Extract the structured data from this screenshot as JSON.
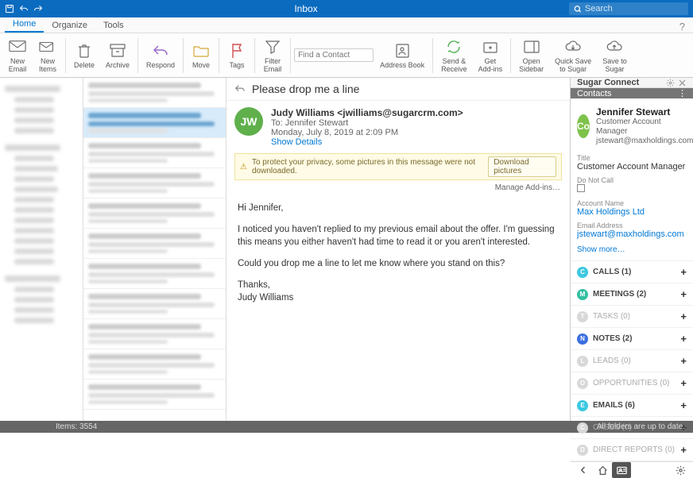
{
  "title": "Inbox",
  "search_placeholder": "Search",
  "tabs": {
    "home": "Home",
    "organize": "Organize",
    "tools": "Tools"
  },
  "ribbon": {
    "new_email": "New\nEmail",
    "new_items": "New\nItems",
    "delete": "Delete",
    "archive": "Archive",
    "respond": "Respond",
    "move": "Move",
    "tags": "Tags",
    "filter_email": "Filter\nEmail",
    "find_contact_placeholder": "Find a Contact",
    "address_book": "Address Book",
    "send_receive": "Send &\nReceive",
    "get_addins": "Get\nAdd-ins",
    "open_sidebar": "Open\nSidebar",
    "quick_save": "Quick Save\nto Sugar",
    "save_sugar": "Save to\nSugar"
  },
  "message": {
    "subject": "Please drop me a line",
    "avatar_initials": "JW",
    "from": "Judy Williams <jwilliams@sugarcrm.com>",
    "to": "To: Jennifer Stewart",
    "date": "Monday, July 8, 2019 at 2:09 PM",
    "show_details": "Show Details",
    "privacy_msg": "To protect your privacy, some pictures in this message were not downloaded.",
    "download_pictures": "Download pictures",
    "manage_addins": "Manage Add-ins…",
    "body_greeting": "Hi Jennifer,",
    "body_p1": "I noticed you haven't replied to my previous email about the offer. I'm guessing this means you either haven't had time to read it or you aren't interested.",
    "body_p2": "Could you drop me a line to let me know where you stand on this?",
    "body_signoff": "Thanks,",
    "body_name": "Judy Williams"
  },
  "sugar": {
    "header": "Sugar Connect",
    "section": "Contacts",
    "avatar": "Co",
    "name": "Jennifer Stewart",
    "title": "Customer Account Manager",
    "email": "jstewart@maxholdings.com",
    "fields": {
      "title_label": "Title",
      "title_value": "Customer Account Manager",
      "dnc_label": "Do Not Call",
      "account_label": "Account Name",
      "account_value": "Max Holdings Ltd",
      "emailaddr_label": "Email Address",
      "emailaddr_value": "jstewart@maxholdings.com"
    },
    "show_more": "Show more…",
    "panels": {
      "calls": "CALLS (1)",
      "meetings": "MEETINGS (2)",
      "tasks": "TASKS (0)",
      "notes": "NOTES (2)",
      "leads": "LEADS (0)",
      "opps": "OPPORTUNITIES (0)",
      "emails": "EMAILS (6)",
      "cases": "CASES (0)",
      "direct_reports": "DIRECT REPORTS (0)"
    }
  },
  "statusbar": {
    "items": "Items: 3554",
    "sync": "All folders are up to date."
  }
}
